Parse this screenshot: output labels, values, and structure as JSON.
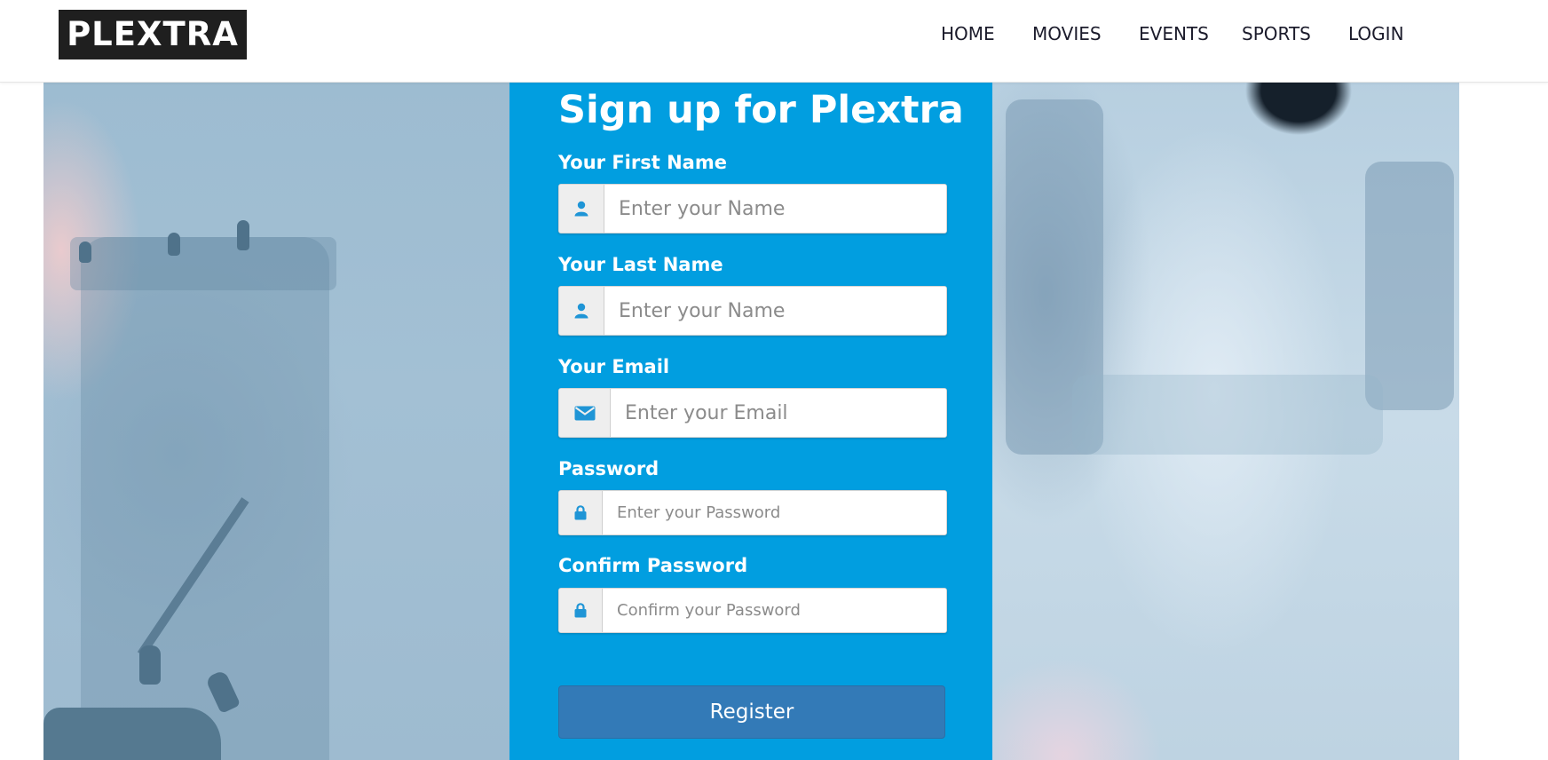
{
  "brand": {
    "logo_text": "PLEXTRA"
  },
  "nav": {
    "items": [
      {
        "label": "HOME"
      },
      {
        "label": "MOVIES"
      },
      {
        "label": "EVENTS"
      },
      {
        "label": "SPORTS"
      },
      {
        "label": "LOGIN"
      }
    ]
  },
  "form": {
    "title": "Sign up for Plextra",
    "fields": [
      {
        "label": "Your First Name",
        "placeholder": "Enter your Name",
        "value": "",
        "icon": "user-icon"
      },
      {
        "label": "Your Last Name",
        "placeholder": "Enter your Name",
        "value": "",
        "icon": "user-icon"
      },
      {
        "label": "Your Email",
        "placeholder": "Enter your Email",
        "value": "",
        "icon": "envelope-icon"
      },
      {
        "label": "Password",
        "placeholder": "Enter your Password",
        "value": "",
        "icon": "lock-icon"
      },
      {
        "label": "Confirm Password",
        "placeholder": "Confirm your Password",
        "value": "",
        "icon": "lock-icon"
      }
    ],
    "submit_label": "Register"
  },
  "colors": {
    "card_background": "#019ee0",
    "button_primary": "#337ab7",
    "icon_color": "#1f95d6",
    "logo_background": "#1f1f1f"
  }
}
